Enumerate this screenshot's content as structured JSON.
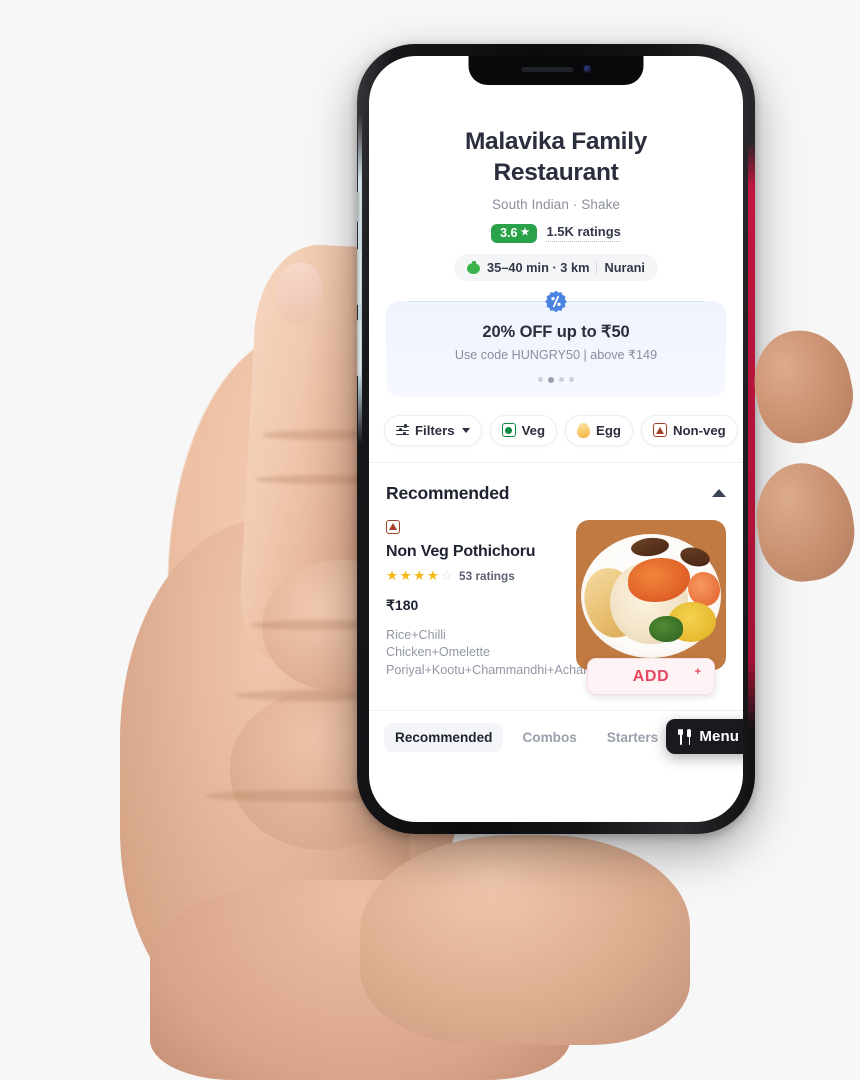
{
  "restaurant": {
    "name": "Malavika Family Restaurant",
    "cuisine": "South Indian · Shake",
    "rating_value": "3.6",
    "rating_star": "★",
    "rating_count": "1.5K ratings",
    "delivery_time": "35–40 min · 3 km",
    "locality": "Nurani"
  },
  "offer": {
    "title": "20% OFF up to ₹50",
    "subtitle": "Use code HUNGRY50 | above ₹149",
    "badge_symbol": "%",
    "dots_total": 4,
    "dot_active_index": 1,
    "accent_color": "#4b83e0",
    "card_bg": "#eef3fd"
  },
  "filters": {
    "filters_label": "Filters",
    "chips": [
      {
        "label": "Veg",
        "marker": "veg-square-icon",
        "color": "#0d8a3f"
      },
      {
        "label": "Egg",
        "marker": "egg-icon",
        "color": "#eeb03f"
      },
      {
        "label": "Non-veg",
        "marker": "nonveg-triangle-icon",
        "color": "#a0412a"
      }
    ]
  },
  "section": {
    "title": "Recommended",
    "collapse_state": "expanded"
  },
  "item": {
    "diet_marker": "nonveg-triangle-icon",
    "name": "Non Veg Pothichoru",
    "stars_filled": 4,
    "stars_total": 5,
    "ratings": "53 ratings",
    "price": "₹180",
    "description": "Rice+Chilli Chicken+Omelette Poriyal+Kootu+Chammandhi+Achar+Sambar+Moru",
    "add_label": "ADD",
    "add_plus": "+",
    "add_color": "#e8475f"
  },
  "tabs": [
    {
      "label": "Recommended",
      "active": true
    },
    {
      "label": "Combos",
      "active": false
    },
    {
      "label": "Starters",
      "active": false
    }
  ],
  "menu_fab": {
    "label": "Menu",
    "icon": "cutlery-icon",
    "bg": "#181a1f"
  }
}
